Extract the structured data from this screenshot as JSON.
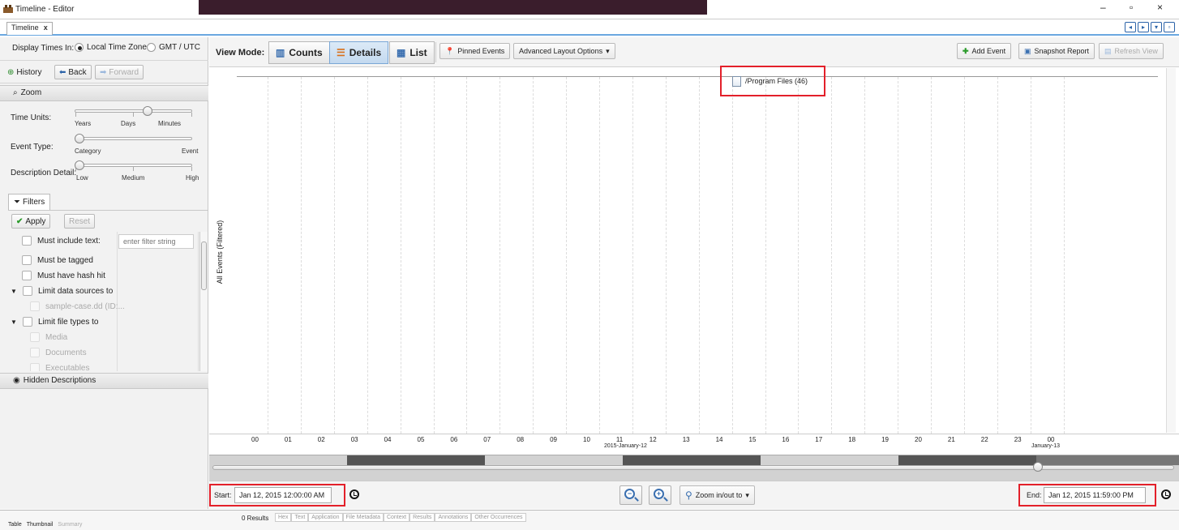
{
  "window": {
    "title": "Timeline - Editor",
    "tab_label": "Timeline",
    "tab_close": "x",
    "minimize": "–",
    "restore": "▫",
    "close": "×"
  },
  "display_times": {
    "label": "Display Times In:",
    "options": [
      "Local Time Zone",
      "GMT / UTC"
    ],
    "selected": "Local Time Zone"
  },
  "history": {
    "label": "History",
    "back": "Back",
    "forward": "Forward"
  },
  "zoom": {
    "title": "Zoom",
    "time_units": {
      "label": "Time Units:",
      "ticks": [
        "Years",
        "Days",
        "Minutes"
      ],
      "value": 0.5
    },
    "event_type": {
      "label": "Event Type:",
      "ticks": [
        "Category",
        "Event"
      ],
      "value": 0
    },
    "description_detail": {
      "label": "Description Detail:",
      "ticks": [
        "Low",
        "Medium",
        "High"
      ],
      "value": 0
    }
  },
  "filters": {
    "tab": "Filters",
    "apply": "Apply",
    "reset": "Reset",
    "text_placeholder": "enter filter string",
    "items": [
      {
        "label": "Must include text:",
        "enabled": true
      },
      {
        "label": "Must be tagged",
        "enabled": true
      },
      {
        "label": "Must have hash hit",
        "enabled": true
      },
      {
        "label": "Limit data sources to",
        "enabled": true,
        "expandable": true
      },
      {
        "label": "sample-case.dd (ID:...",
        "enabled": false
      },
      {
        "label": "Limit file types to",
        "enabled": true,
        "expandable": true
      },
      {
        "label": "Media",
        "enabled": false
      },
      {
        "label": "Documents",
        "enabled": false
      },
      {
        "label": "Executables",
        "enabled": false
      }
    ]
  },
  "hidden_descriptions": "Hidden Descriptions",
  "toolbar": {
    "view_mode_label": "View Mode:",
    "counts": "Counts",
    "details": "Details",
    "list": "List",
    "pinned_events": "Pinned Events",
    "advanced_layout": "Advanced Layout Options",
    "add_event": "Add Event",
    "snapshot_report": "Snapshot Report",
    "refresh_view": "Refresh View"
  },
  "chart": {
    "y_label": "All Events (Filtered)",
    "event_cluster": "/Program Files  (46)",
    "hours": [
      "00",
      "01",
      "02",
      "03",
      "04",
      "05",
      "06",
      "07",
      "08",
      "09",
      "10",
      "11",
      "12",
      "13",
      "14",
      "15",
      "16",
      "17",
      "18",
      "19",
      "20",
      "21",
      "22",
      "23",
      "00"
    ],
    "date_label_1": "2015-January-12",
    "date_label_2": "January-13"
  },
  "range": {
    "start_label": "Start:",
    "start_value": "Jan 12, 2015 12:00:00 AM",
    "end_label": "End:",
    "end_value": "Jan 12, 2015 11:59:00 PM",
    "zoom_menu": "Zoom in/out to"
  },
  "results": {
    "count": "0 Results",
    "tabs": [
      "Hex",
      "Text",
      "Application",
      "File Metadata",
      "Context",
      "Results",
      "Annotations",
      "Other Occurrences"
    ],
    "bottom_tabs": [
      "Table",
      "Thumbnail",
      "Summary"
    ]
  },
  "colors": {
    "highlight": "#e3202a",
    "accent": "#2b63a8"
  }
}
